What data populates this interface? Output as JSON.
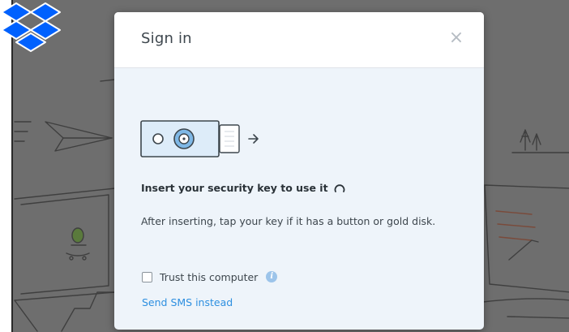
{
  "dialog": {
    "title": "Sign in",
    "close_symbol": "×",
    "heading": "Insert your security key to use it",
    "instruction": "After inserting, tap your key if it has a button or gold disk.",
    "trust_label": "Trust this computer",
    "trust_checked": false,
    "info_symbol": "i",
    "sms_link": "Send SMS instead"
  },
  "icons": {
    "logo": "dropbox-logo-icon",
    "close": "close-icon",
    "illustration": "security-key-icon",
    "spinner": "loading-spinner-icon",
    "info": "info-icon"
  },
  "colors": {
    "overlay": "#6e6e6e",
    "dialog_body": "#eef4fa",
    "link": "#2d8fe0",
    "brand": "#0061fe"
  }
}
